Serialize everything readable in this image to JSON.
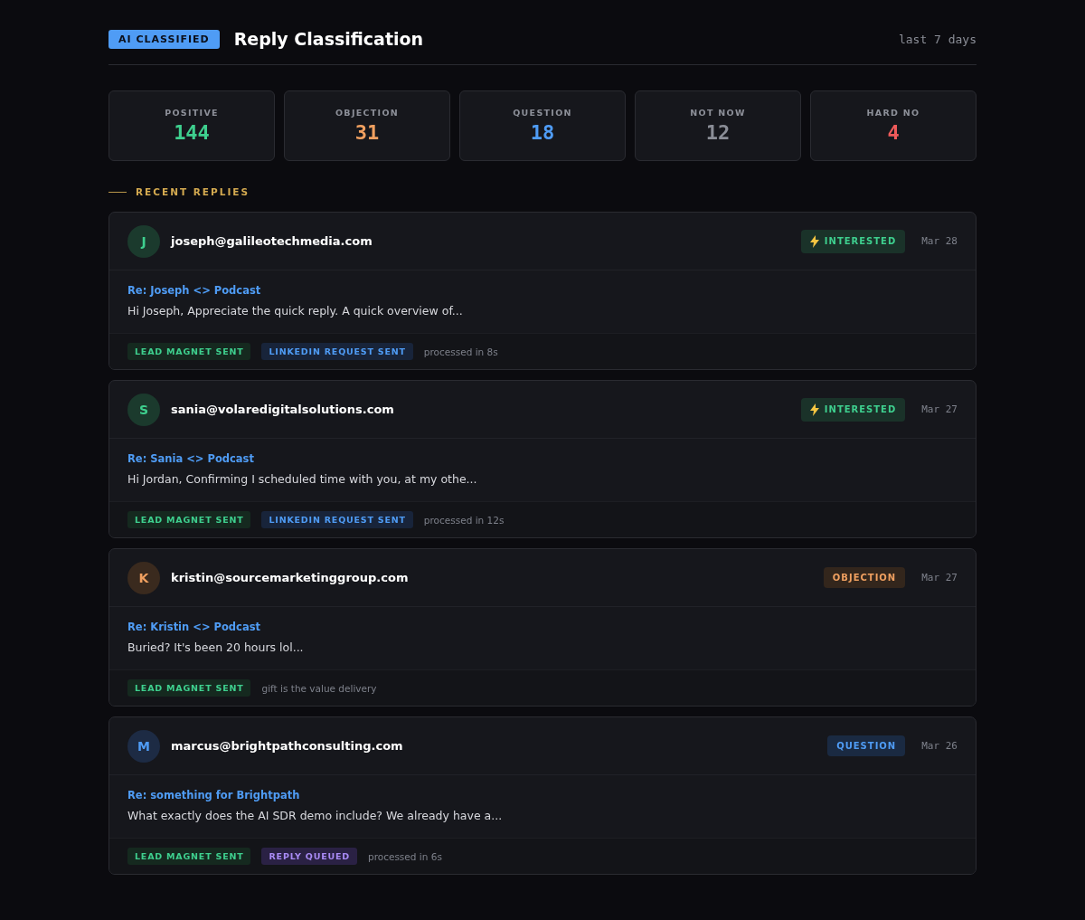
{
  "header": {
    "badge": "AI CLASSIFIED",
    "title": "Reply Classification",
    "range": "last 7 days"
  },
  "stats": [
    {
      "label": "POSITIVE",
      "value": "144",
      "color": "#3ecf8e"
    },
    {
      "label": "OBJECTION",
      "value": "31",
      "color": "#f0a060"
    },
    {
      "label": "QUESTION",
      "value": "18",
      "color": "#4f9cf5"
    },
    {
      "label": "NOT NOW",
      "value": "12",
      "color": "#8a8d96"
    },
    {
      "label": "HARD NO",
      "value": "4",
      "color": "#ef5a5a"
    }
  ],
  "section_title": "RECENT REPLIES",
  "replies": [
    {
      "initial": "J",
      "email": "joseph@galileotechmedia.com",
      "status": {
        "kind": "interested",
        "label": "INTERESTED"
      },
      "date": "Mar 28",
      "subject": "Re: Joseph <> Podcast",
      "preview": "Hi Joseph, Appreciate the quick reply. A quick overview of...",
      "tags": [
        {
          "kind": "green",
          "label": "LEAD MAGNET SENT"
        },
        {
          "kind": "blue",
          "label": "LINKEDIN REQUEST SENT"
        }
      ],
      "note": "processed in 8s"
    },
    {
      "initial": "S",
      "email": "sania@volaredigitalsolutions.com",
      "status": {
        "kind": "interested",
        "label": "INTERESTED"
      },
      "date": "Mar 27",
      "subject": "Re: Sania <> Podcast",
      "preview": "Hi Jordan, Confirming I scheduled time with you, at my othe...",
      "tags": [
        {
          "kind": "green",
          "label": "LEAD MAGNET SENT"
        },
        {
          "kind": "blue",
          "label": "LINKEDIN REQUEST SENT"
        }
      ],
      "note": "processed in 12s"
    },
    {
      "initial": "K",
      "email": "kristin@sourcemarketinggroup.com",
      "status": {
        "kind": "objection",
        "label": "OBJECTION"
      },
      "date": "Mar 27",
      "subject": "Re: Kristin <> Podcast",
      "preview": "Buried? It's been 20 hours lol...",
      "tags": [
        {
          "kind": "green",
          "label": "LEAD MAGNET SENT"
        }
      ],
      "note": "gift is the value delivery"
    },
    {
      "initial": "M",
      "email": "marcus@brightpathconsulting.com",
      "status": {
        "kind": "question",
        "label": "QUESTION"
      },
      "date": "Mar 26",
      "subject": "Re: something for Brightpath",
      "preview": "What exactly does the AI SDR demo include? We already have a...",
      "tags": [
        {
          "kind": "green",
          "label": "LEAD MAGNET SENT"
        },
        {
          "kind": "purple",
          "label": "REPLY QUEUED"
        }
      ],
      "note": "processed in 6s"
    }
  ]
}
